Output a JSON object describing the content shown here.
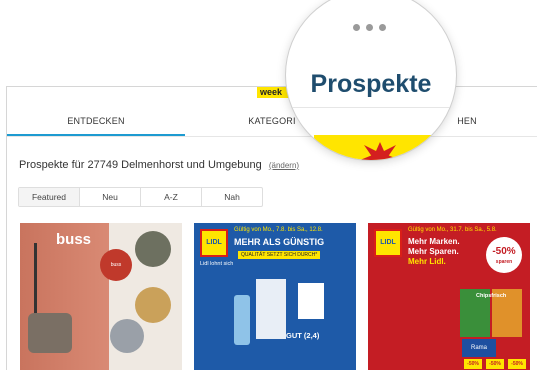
{
  "brand": {
    "logo_text": "week"
  },
  "tabs": [
    {
      "label": "ENTDECKEN",
      "active": true
    },
    {
      "label": "KATEGORI"
    },
    {
      "label": "HEN"
    }
  ],
  "magnifier": {
    "title": "Prospekte"
  },
  "location": {
    "text": "Prospekte für 27749 Delmenhorst und Umgebung",
    "change_link": "(ändern)"
  },
  "filters": [
    {
      "label": "Featured",
      "active": true
    },
    {
      "label": "Neu"
    },
    {
      "label": "A-Z"
    },
    {
      "label": "Nah"
    }
  ],
  "cards": {
    "buss": {
      "brand": "buss",
      "badge": "buss"
    },
    "lidl1": {
      "logo": "LIDL",
      "dates": "Gültig von Mo., 7.8. bis Sa., 12.8.",
      "headline": "MEHR ALS GÜNSTIG",
      "subline": "QUALITÄT SETZT SICH DURCH*",
      "claim": "Lidl lohnt sich",
      "rating": "GUT (2,4)"
    },
    "lidl2": {
      "logo": "LIDL",
      "dates": "Gültig von Mo., 31.7. bis Sa., 5.8.",
      "line1": "Mehr Marken.",
      "line2": "Mehr Sparen.",
      "line3": "Mehr Lidl.",
      "discount": "-50%",
      "discount_sub": "sparen",
      "chips": "Chipsfrisch",
      "rama": "Rama",
      "price_tags": [
        "-50%",
        "-50%",
        "-50%"
      ]
    }
  },
  "colors": {
    "accent_blue": "#1d9bd1",
    "lidl_blue": "#1e5aa8",
    "lidl_red": "#c41d24",
    "yellow": "#ffe500",
    "title_blue": "#1f4d6e"
  }
}
